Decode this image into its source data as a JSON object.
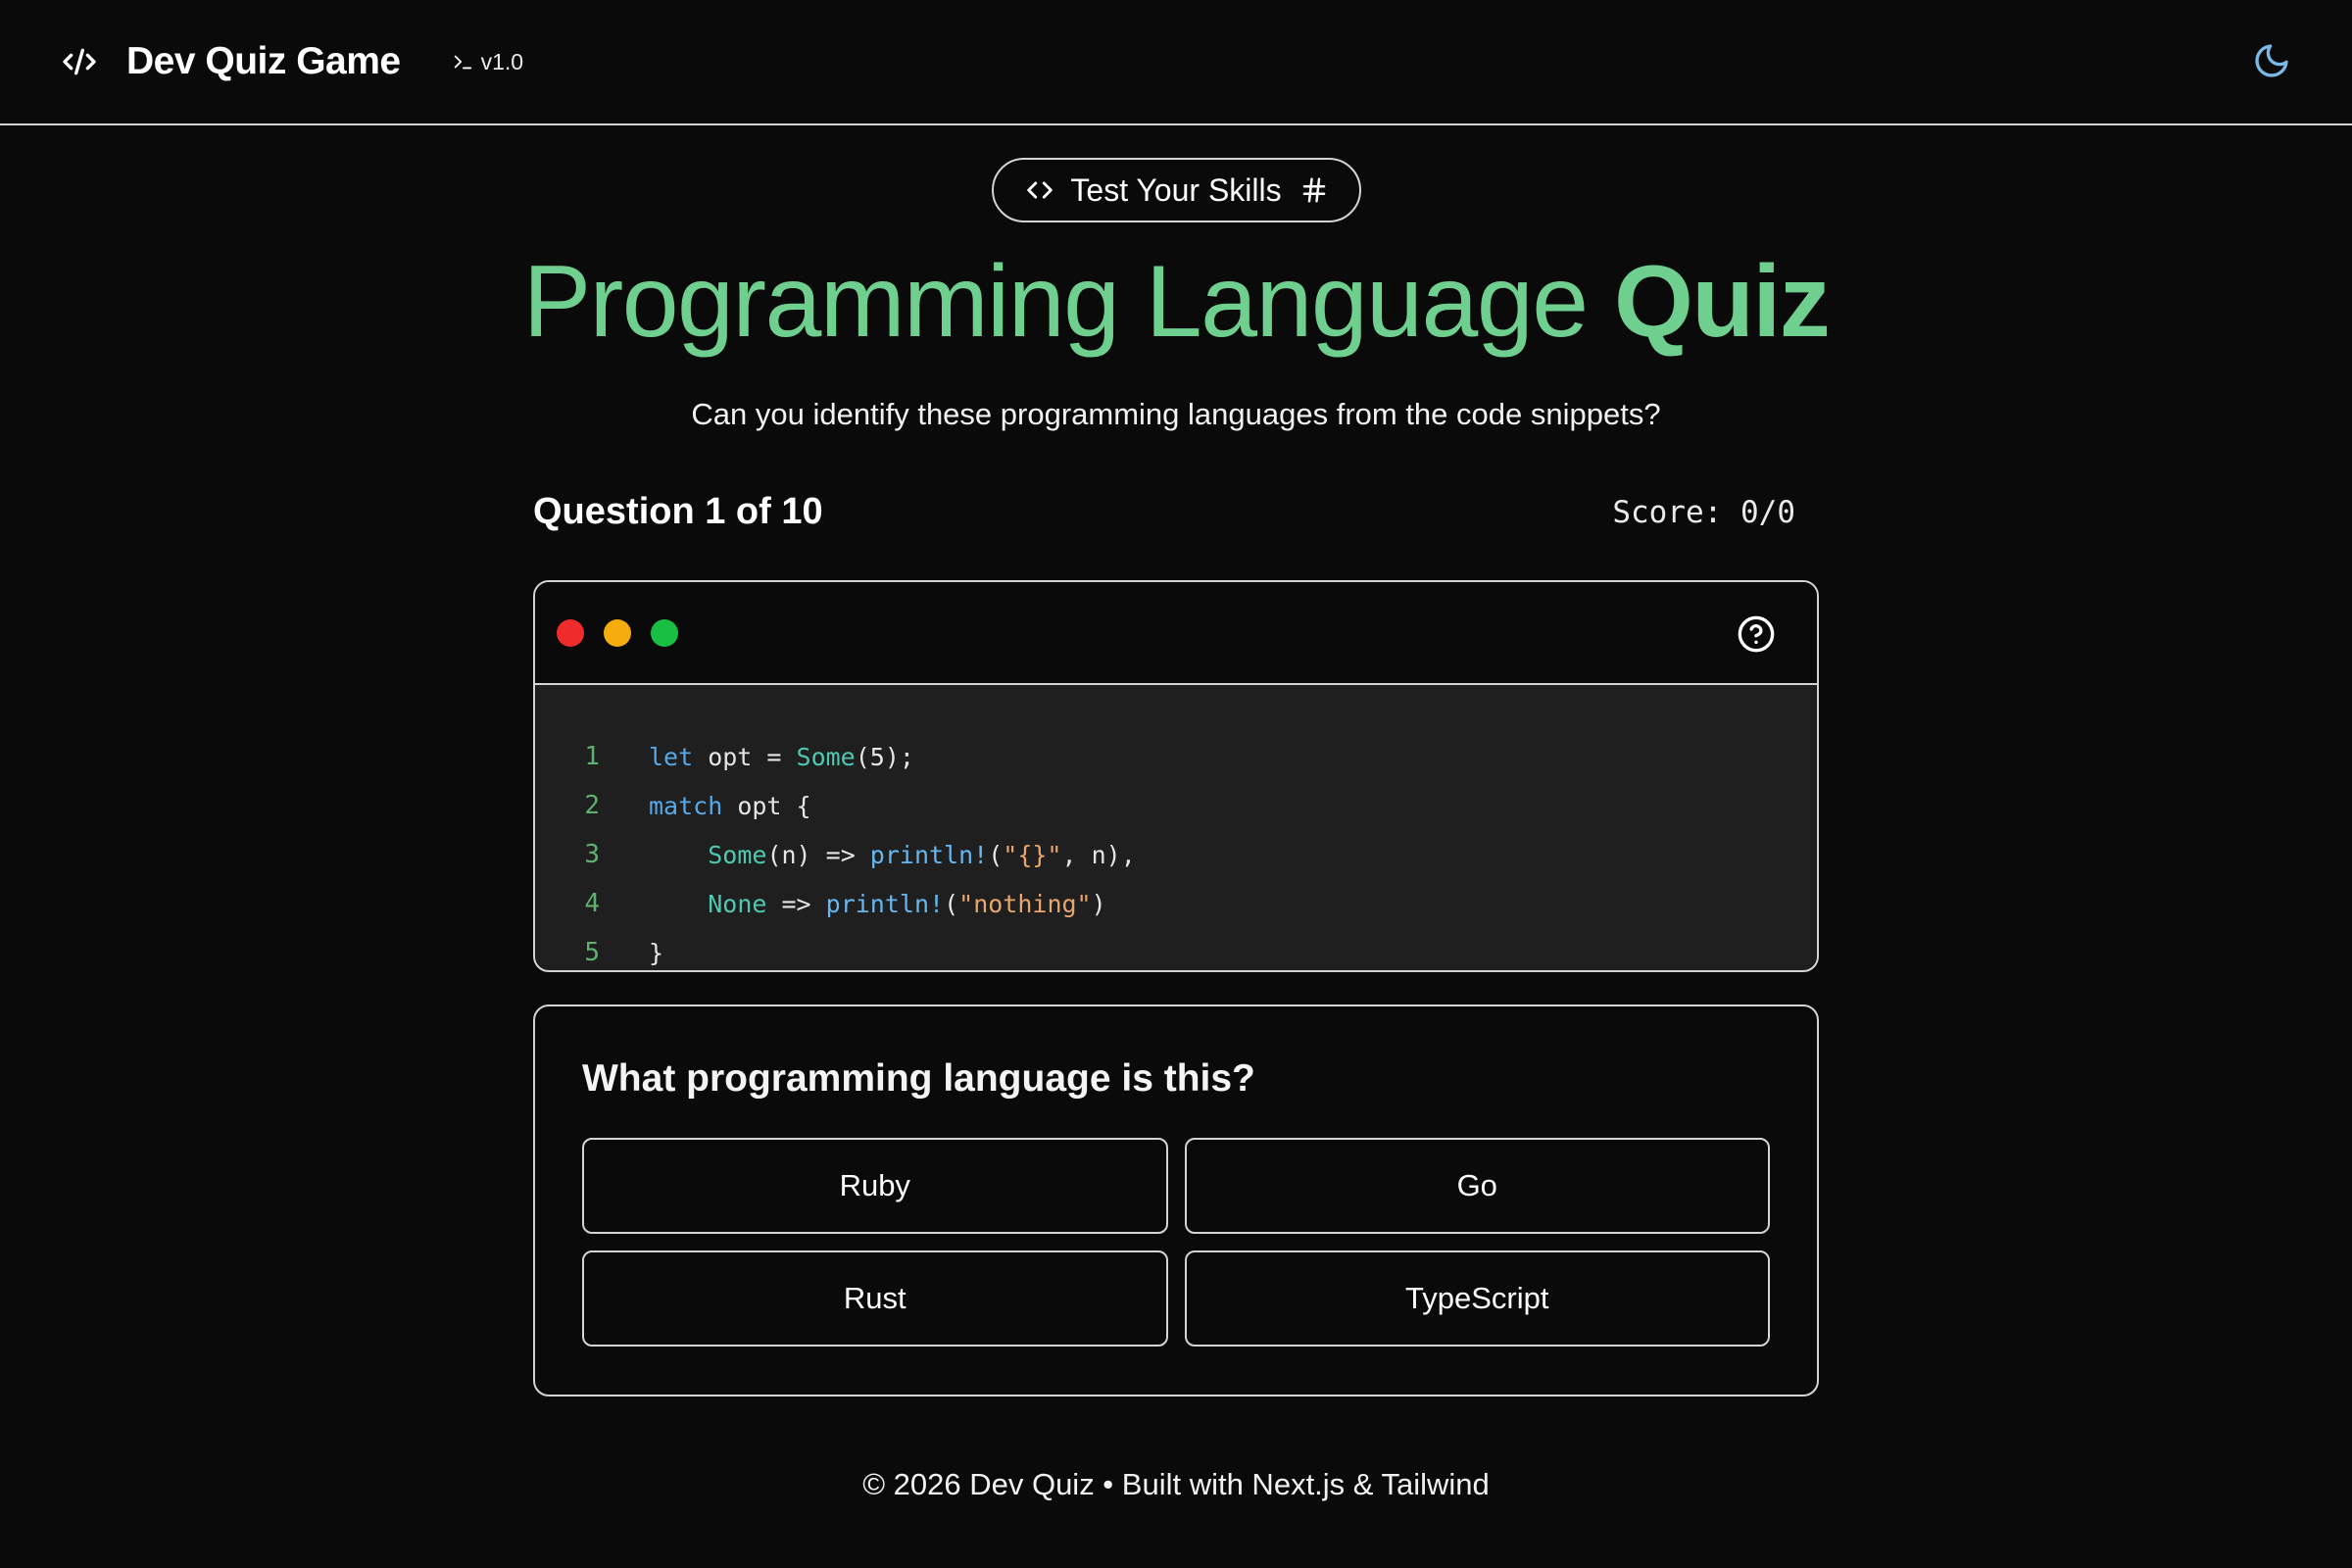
{
  "header": {
    "brand_title": "Dev Quiz Game",
    "version": "v1.0",
    "icons": {
      "logo": "code-icon",
      "version": "terminal-prompt-icon",
      "theme": "moon-icon"
    }
  },
  "hero": {
    "badge_label": "Test Your Skills",
    "title_regular": "Programming Language",
    "title_bold": "Quiz",
    "subtitle": "Can you identify these programming languages from the code snippets?"
  },
  "status": {
    "question_count": "Question 1 of 10",
    "score": "Score: 0/0"
  },
  "code_window": {
    "line_numbers": [
      "1",
      "2",
      "3",
      "4",
      "5"
    ],
    "lines": [
      "let opt = Some(5);",
      "match opt {",
      "    Some(n) => println!(\"{}\", n),",
      "    None => println!(\"nothing\")",
      "}"
    ]
  },
  "answer": {
    "question": "What programming language is this?",
    "options": [
      "Ruby",
      "Go",
      "Rust",
      "TypeScript"
    ]
  },
  "footer": {
    "text": "© 2026 Dev Quiz • Built with Next.js & Tailwind"
  },
  "colors": {
    "background": "#0a0a0a",
    "accent_green": "#6fcf8f",
    "border": "#d4d4d4",
    "dot_red": "#ef2b2b",
    "dot_yellow": "#f4ad0c",
    "dot_green": "#17c043",
    "theme_icon": "#7ab8e6"
  }
}
